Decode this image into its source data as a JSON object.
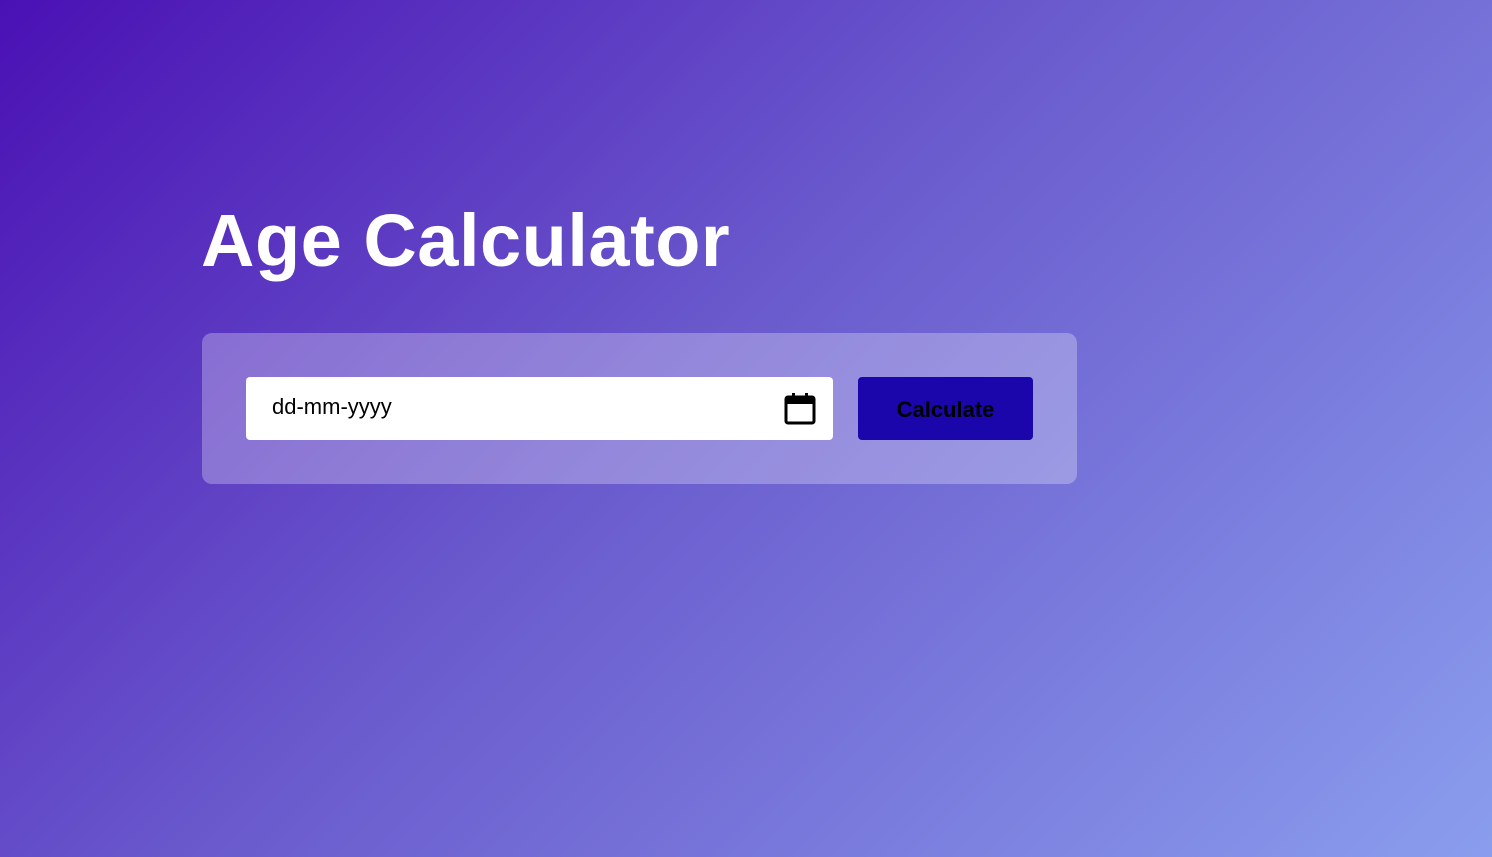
{
  "header": {
    "title": "Age Calculator"
  },
  "form": {
    "date_placeholder": "dd-mm-yyyy",
    "calendar_icon": "calendar-icon",
    "calculate_label": "Calculate"
  },
  "colors": {
    "background_start": "#4a10b4",
    "background_end": "#8a9ded",
    "button": "#1a06aa",
    "title_text": "#ffffff"
  }
}
